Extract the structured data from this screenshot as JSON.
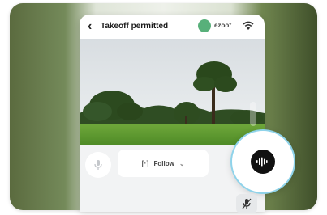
{
  "topbar": {
    "back_icon": "chevron-left-icon",
    "title": "Takeoff permitted",
    "status_text": "ezoo°",
    "status_color": "#58b07a",
    "wifi_icon": "wifi-icon"
  },
  "controls": {
    "mic_icon": "microphone-icon",
    "follow_label": "Follow",
    "follow_glyph": "[·]",
    "follow_chevron": "⌄",
    "voice_icon": "voice-waveform-icon",
    "mute_icon": "microphone-off-icon"
  },
  "colors": {
    "accent_ring": "#8fd3ea",
    "voice_button": "#111111"
  }
}
